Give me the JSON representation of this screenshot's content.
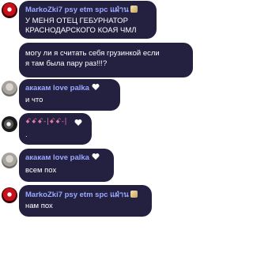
{
  "messages": [
    {
      "sender": "MarkoZki7 psy etm spc แฝ่าน",
      "lines": [
        "У МЕНЯ ОТЕЦ ГЕБУРНАТОР",
        "КРАСНОДАРСКОГО КОАЯ ЧМЛ"
      ]
    },
    {
      "lines": [
        "могу ли я считать себя грузинкой если",
        "я там была пару раз!!!?"
      ]
    },
    {
      "sender": "акакам love palka",
      "lines": [
        "и что"
      ]
    },
    {
      "sender": "ꗃꗃꗃ-|ꗃꗃ-|",
      "lines": [
        "."
      ]
    },
    {
      "sender": "акакам love palka",
      "lines": [
        "всем пох"
      ]
    },
    {
      "sender": "MarkoZki7 psy etm spc แฝ่าน",
      "lines": [
        "нам пох"
      ]
    }
  ],
  "icons": {
    "badge": "vip-badge-icon",
    "heart": "heart-icon"
  },
  "colors": {
    "bubble_bg": "#242040",
    "name_color": "#9aa9ff",
    "text_color": "#ffffff"
  }
}
